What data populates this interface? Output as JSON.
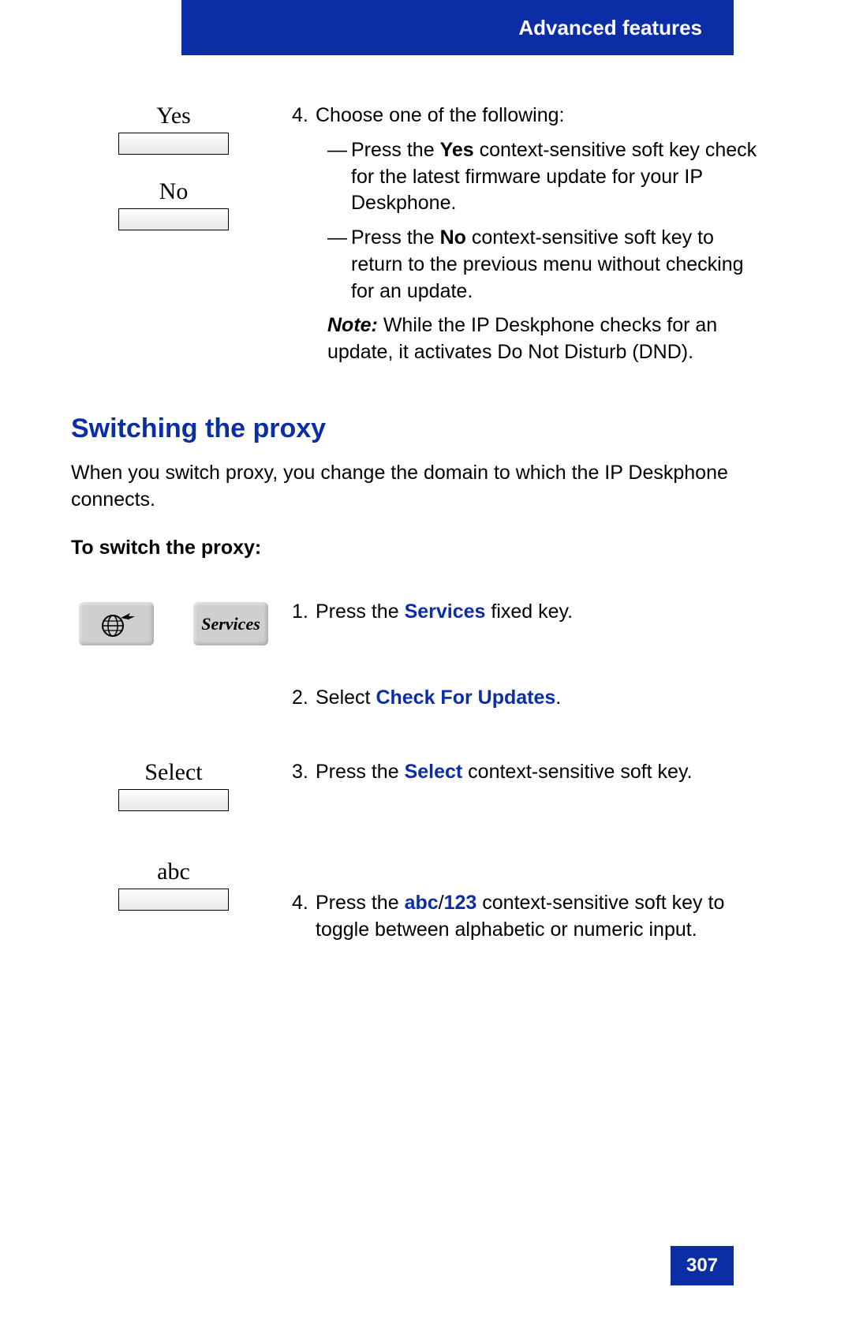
{
  "header": {
    "title": "Advanced features"
  },
  "page_number": "307",
  "softkeys": {
    "yes": "Yes",
    "no": "No",
    "select": "Select",
    "abc": "abc"
  },
  "services_key_label": "Services",
  "step4": {
    "num": "4.",
    "intro": "Choose one of the following:",
    "dash": "—",
    "opt1_a": "Press the ",
    "opt1_b": "Yes",
    "opt1_c": " context-sensitive soft key check for the latest firmware update for your IP Deskphone.",
    "opt2_a": "Press the ",
    "opt2_b": "No",
    "opt2_c": " context-sensitive soft key to return to the previous menu without checking for an update.",
    "note_label": "Note:",
    "note_text": "  While the IP Deskphone checks for an update, it activates Do Not Disturb (DND)."
  },
  "section": {
    "title": "Switching the proxy",
    "intro": "When you switch proxy, you change the domain to which the IP Deskphone connects.",
    "sub": "To switch the proxy:"
  },
  "steps": {
    "s1": {
      "num": "1.",
      "a": "Press the ",
      "b": "Services",
      "c": " fixed key."
    },
    "s2": {
      "num": "2.",
      "a": "Select ",
      "b": "Check For Updates",
      "c": "."
    },
    "s3": {
      "num": "3.",
      "a": "Press the ",
      "b": "Select",
      "c": " context-sensitive soft key."
    },
    "s4": {
      "num": "4.",
      "a": "Press the ",
      "b": "abc",
      "slash": "/",
      "d": "123",
      "e": " context-sensitive soft key to toggle between alphabetic or numeric input."
    }
  }
}
